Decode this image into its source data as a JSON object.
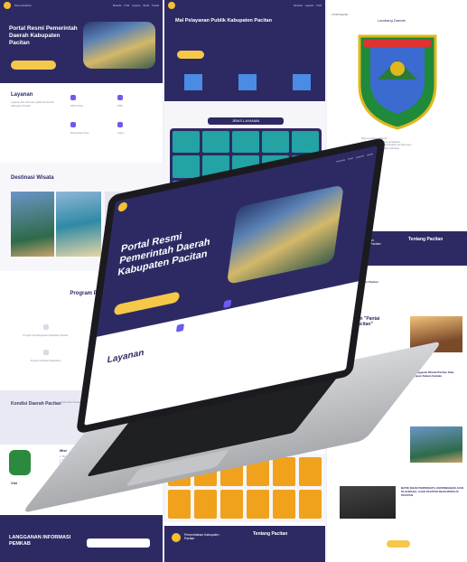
{
  "left": {
    "site_title": "Portal Resmi Pemerintah Daerah Kabupaten Pacitan",
    "layanan_title": "Layanan",
    "layanan_items": [
      "SKM Online",
      "PPID",
      "Ruang Rapt Pujiu",
      "Lapor!"
    ],
    "destinasi_title": "Destinasi Wisata",
    "program_title": "Program Pe... Kabupaten",
    "program_items": [
      "Program Pembangunan Kabupaten Pacitan",
      "Pacitan...",
      "Program Hilirisasi Kabupaten",
      "Program Ketahanan Pangan Nasional"
    ],
    "kondisi_title": "Kondisi Daerah Pacitan",
    "misi_title": "Misi",
    "visi_title": "Visi",
    "langganan_title": "LANGGANAN INFORMASI PEMKAB"
  },
  "mid": {
    "mal_title": "Mal Pelayanan Publik Kabupaten Pacitan",
    "jenis_layanan": "JENIS LAYANAN",
    "footer_title": "Pemerintahan Kabupaten Pacitan",
    "footer_tentang": "Tentang Pacitan"
  },
  "right": {
    "lambang_title": "Lambang Daerah",
    "tentang_title": "Tentang Pacitan",
    "tentang_sub": "Pemerintahan Kabupaten Pacitan",
    "pariwisata_title": "Pariwisata Kabupaten Pacitan",
    "news1": "Keindahan \"Pantai Klayar Pacitan\"",
    "news2": "Pariwisata Penggerak Wisata Pacitan Kala Cenderung Ajuan Kalaan Selatan",
    "news3": "BATIK DHAN PARIWISATA, KEPAWEABAN, DAN OLAHRAGA, AJAK PACITAN SEJAHTERA DI PACITAN"
  },
  "laptop": {
    "hero_title": "Portal Resmi Pemerintah Daerah Kabupaten Pacitan",
    "section": "Layanan"
  }
}
